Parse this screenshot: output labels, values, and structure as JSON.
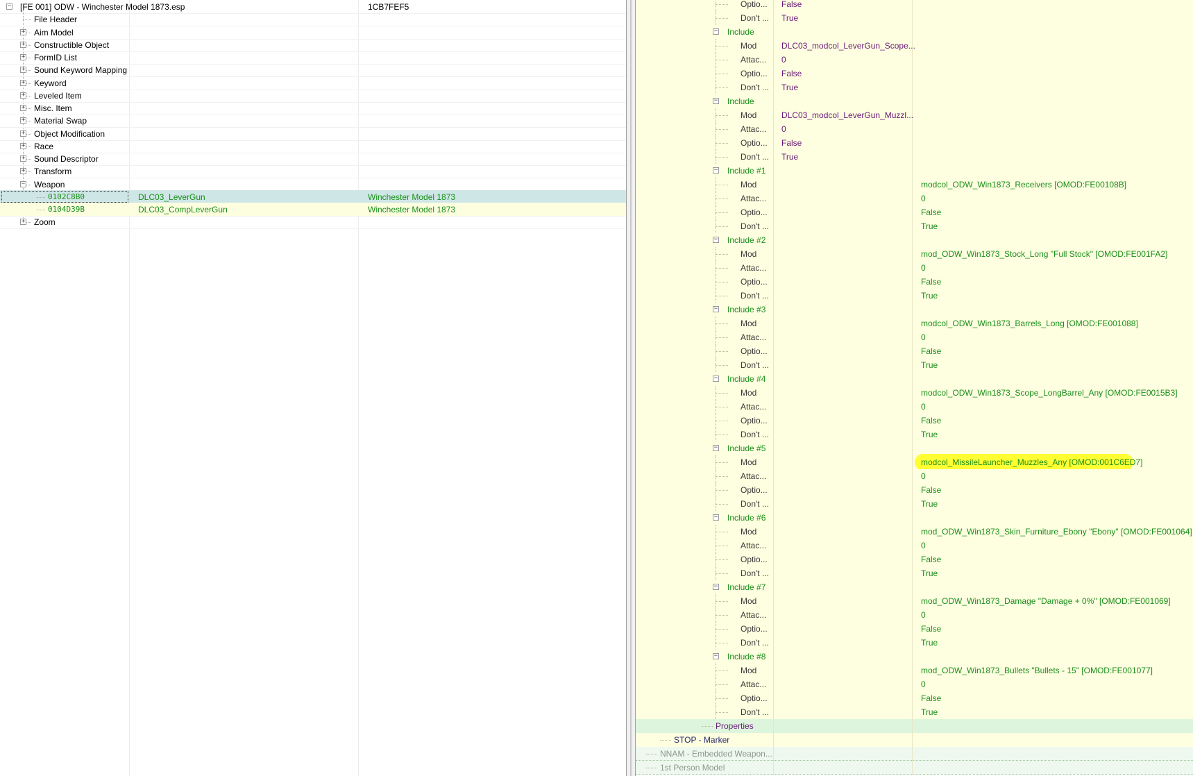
{
  "left": {
    "root": {
      "label": "[FE 001] ODW - Winchester Model 1873.esp",
      "value": "1CB7FEF5"
    },
    "groups": [
      {
        "label": "File Header",
        "expander": ""
      },
      {
        "label": "Aim Model",
        "expander": "+"
      },
      {
        "label": "Constructible Object",
        "expander": "+"
      },
      {
        "label": "FormID List",
        "expander": "+"
      },
      {
        "label": "Sound Keyword Mapping",
        "expander": "+"
      },
      {
        "label": "Keyword",
        "expander": "+"
      },
      {
        "label": "Leveled Item",
        "expander": "+"
      },
      {
        "label": "Misc. Item",
        "expander": "+"
      },
      {
        "label": "Material Swap",
        "expander": "+"
      },
      {
        "label": "Object Modification",
        "expander": "+"
      },
      {
        "label": "Race",
        "expander": "+"
      },
      {
        "label": "Sound Descriptor",
        "expander": "+"
      },
      {
        "label": "Transform",
        "expander": "+"
      },
      {
        "label": "Weapon",
        "expander": "−"
      }
    ],
    "weapons": [
      {
        "formid": "0102C8B0",
        "editor_id": "DLC03_LeverGun",
        "name": "Winchester Model 1873"
      },
      {
        "formid": "0104D39B",
        "editor_id": "DLC03_CompLeverGun",
        "name": "Winchester Model 1873"
      }
    ],
    "last_group": {
      "label": "Zoom",
      "expander": "+"
    }
  },
  "right": {
    "top_fields": [
      {
        "label": "Optio...",
        "v2": "False"
      },
      {
        "label": "Don't ...",
        "v2": "True"
      }
    ],
    "mid_includes": [
      {
        "label": "Include",
        "fields": [
          {
            "label": "Mod",
            "v2": "DLC03_modcol_LeverGun_Scope..."
          },
          {
            "label": "Attac...",
            "v2": "0"
          },
          {
            "label": "Optio...",
            "v2": "False"
          },
          {
            "label": "Don't ...",
            "v2": "True"
          }
        ]
      },
      {
        "label": "Include",
        "fields": [
          {
            "label": "Mod",
            "v2": "DLC03_modcol_LeverGun_Muzzl..."
          },
          {
            "label": "Attac...",
            "v2": "0"
          },
          {
            "label": "Optio...",
            "v2": "False"
          },
          {
            "label": "Don't ...",
            "v2": "True"
          }
        ]
      }
    ],
    "numbered_includes": [
      {
        "label": "Include #1",
        "fields": [
          {
            "label": "Mod",
            "v3": "modcol_ODW_Win1873_Receivers [OMOD:FE00108B]"
          },
          {
            "label": "Attac...",
            "v3": "0"
          },
          {
            "label": "Optio...",
            "v3": "False"
          },
          {
            "label": "Don't ...",
            "v3": "True"
          }
        ]
      },
      {
        "label": "Include #2",
        "fields": [
          {
            "label": "Mod",
            "v3": "mod_ODW_Win1873_Stock_Long \"Full Stock\" [OMOD:FE001FA2]"
          },
          {
            "label": "Attac...",
            "v3": "0"
          },
          {
            "label": "Optio...",
            "v3": "False"
          },
          {
            "label": "Don't ...",
            "v3": "True"
          }
        ]
      },
      {
        "label": "Include #3",
        "fields": [
          {
            "label": "Mod",
            "v3": "modcol_ODW_Win1873_Barrels_Long [OMOD:FE001088]"
          },
          {
            "label": "Attac...",
            "v3": "0"
          },
          {
            "label": "Optio...",
            "v3": "False"
          },
          {
            "label": "Don't ...",
            "v3": "True"
          }
        ]
      },
      {
        "label": "Include #4",
        "fields": [
          {
            "label": "Mod",
            "v3": "modcol_ODW_Win1873_Scope_LongBarrel_Any [OMOD:FE0015B3]"
          },
          {
            "label": "Attac...",
            "v3": "0"
          },
          {
            "label": "Optio...",
            "v3": "False"
          },
          {
            "label": "Don't ...",
            "v3": "True"
          }
        ]
      },
      {
        "label": "Include #5",
        "fields": [
          {
            "label": "Mod",
            "v3": "modcol_MissileLauncher_Muzzles_Any [OMOD:001C6ED7]",
            "highlight": true
          },
          {
            "label": "Attac...",
            "v3": "0"
          },
          {
            "label": "Optio...",
            "v3": "False"
          },
          {
            "label": "Don't ...",
            "v3": "True"
          }
        ]
      },
      {
        "label": "Include #6",
        "fields": [
          {
            "label": "Mod",
            "v3": "mod_ODW_Win1873_Skin_Furniture_Ebony \"Ebony\" [OMOD:FE001064]"
          },
          {
            "label": "Attac...",
            "v3": "0"
          },
          {
            "label": "Optio...",
            "v3": "False"
          },
          {
            "label": "Don't ...",
            "v3": "True"
          }
        ]
      },
      {
        "label": "Include #7",
        "fields": [
          {
            "label": "Mod",
            "v3": "mod_ODW_Win1873_Damage \"Damage + 0%\" [OMOD:FE001069]"
          },
          {
            "label": "Attac...",
            "v3": "0"
          },
          {
            "label": "Optio...",
            "v3": "False"
          },
          {
            "label": "Don't ...",
            "v3": "True"
          }
        ]
      },
      {
        "label": "Include #8",
        "fields": [
          {
            "label": "Mod",
            "v3": "mod_ODW_Win1873_Bullets \"Bullets - 15\" [OMOD:FE001077]"
          },
          {
            "label": "Attac...",
            "v3": "0"
          },
          {
            "label": "Optio...",
            "v3": "False"
          },
          {
            "label": "Don't ...",
            "v3": "True"
          }
        ]
      }
    ],
    "tail": [
      {
        "label": "Properties",
        "kind": "prop"
      },
      {
        "label": "STOP - Marker",
        "kind": "stop"
      },
      {
        "label": "NNAM - Embedded Weapon...",
        "kind": "grey"
      },
      {
        "label": "1st Person Model",
        "kind": "grey"
      }
    ]
  },
  "colors": {
    "highlight": "#ffff33",
    "green_text": "#1a8f1a",
    "purple_text": "#6a1a7a",
    "row_yellow": "#fefee0",
    "row_green": "#ddf5dd"
  }
}
